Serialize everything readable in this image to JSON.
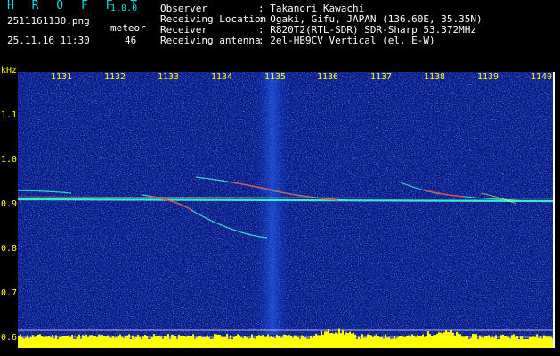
{
  "header": {
    "brand": "H R O F F T",
    "version": "1.0.0",
    "filename": "2511161130.png",
    "meteor_label": "meteor",
    "datetime": "25.11.16 11:30",
    "meteor_count": "46",
    "info": [
      {
        "key": "Observer",
        "value": ": Takanori Kawachi"
      },
      {
        "key": "Receiving Location",
        "value": ": Ogaki, Gifu, JAPAN (136.60E, 35.35N)"
      },
      {
        "key": "Receiver",
        "value": ": R820T2(RTL-SDR) SDR-Sharp 53.372MHz"
      },
      {
        "key": "Receiving antenna",
        "value": ": 2el-HB9CV Vertical (el. E-W)"
      }
    ]
  },
  "axes": {
    "y_unit": "kHz",
    "x_ticks": [
      "1131",
      "1132",
      "1133",
      "1134",
      "1135",
      "1136",
      "1137",
      "1138",
      "1139",
      "1140"
    ],
    "y_ticks": [
      "1.1",
      "1.0",
      "0.9",
      "0.8",
      "0.7",
      "0.6"
    ]
  },
  "colors": {
    "background": "#000000",
    "spectrogram_base": "#0a1a8a",
    "noise": "#3fa0ff",
    "signal_hot": "#ff3030",
    "signal_warm": "#ffff40",
    "carrier": "#40ffd0",
    "histogram": "#ffff00",
    "text_cyan": "#00e0e0",
    "text_yellow": "#ffff00"
  }
}
